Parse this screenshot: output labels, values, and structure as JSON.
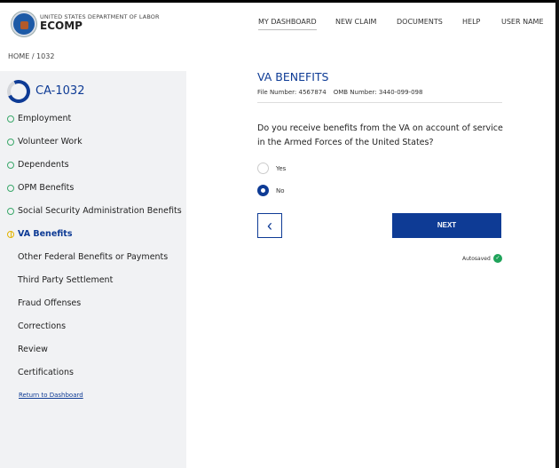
{
  "header": {
    "agency": "UNITED STATES DEPARTMENT OF LABOR",
    "app_name": "ECOMP",
    "nav": [
      "MY DASHBOARD",
      "NEW CLAIM",
      "DOCUMENTS",
      "HELP",
      "USER NAME"
    ]
  },
  "breadcrumb": "HOME  /  1032",
  "sidebar": {
    "claim_id": "CA-1032",
    "items": [
      {
        "label": "Employment",
        "status": "complete"
      },
      {
        "label": "Volunteer Work",
        "status": "complete"
      },
      {
        "label": "Dependents",
        "status": "complete"
      },
      {
        "label": "OPM Benefits",
        "status": "complete"
      },
      {
        "label": "Social Security Administration Benefits",
        "status": "complete"
      },
      {
        "label": "VA Benefits",
        "status": "current"
      },
      {
        "label": "Other Federal Benefits or Payments",
        "status": "pending"
      },
      {
        "label": "Third Party Settlement",
        "status": "pending"
      },
      {
        "label": "Fraud Offenses",
        "status": "pending"
      },
      {
        "label": "Corrections",
        "status": "pending"
      },
      {
        "label": "Review",
        "status": "pending"
      },
      {
        "label": "Certifications",
        "status": "pending"
      }
    ],
    "return_link": "Return to Dashboard"
  },
  "main": {
    "title": "VA BENEFITS",
    "file_number": "File Number: 4567874",
    "omb_number": "OMB Number: 3440-099-098",
    "question": "Do you receive benefits from the VA on account of service in the Armed Forces of the United States?",
    "options": [
      {
        "label": "Yes",
        "selected": false
      },
      {
        "label": "No",
        "selected": true
      }
    ],
    "back_icon": "‹",
    "next_label": "NEXT",
    "autosave": "Autosaved",
    "check": "✓"
  },
  "colors": {
    "primary": "#0e3b95",
    "success": "#1fa35a",
    "warning": "#e3b400"
  }
}
